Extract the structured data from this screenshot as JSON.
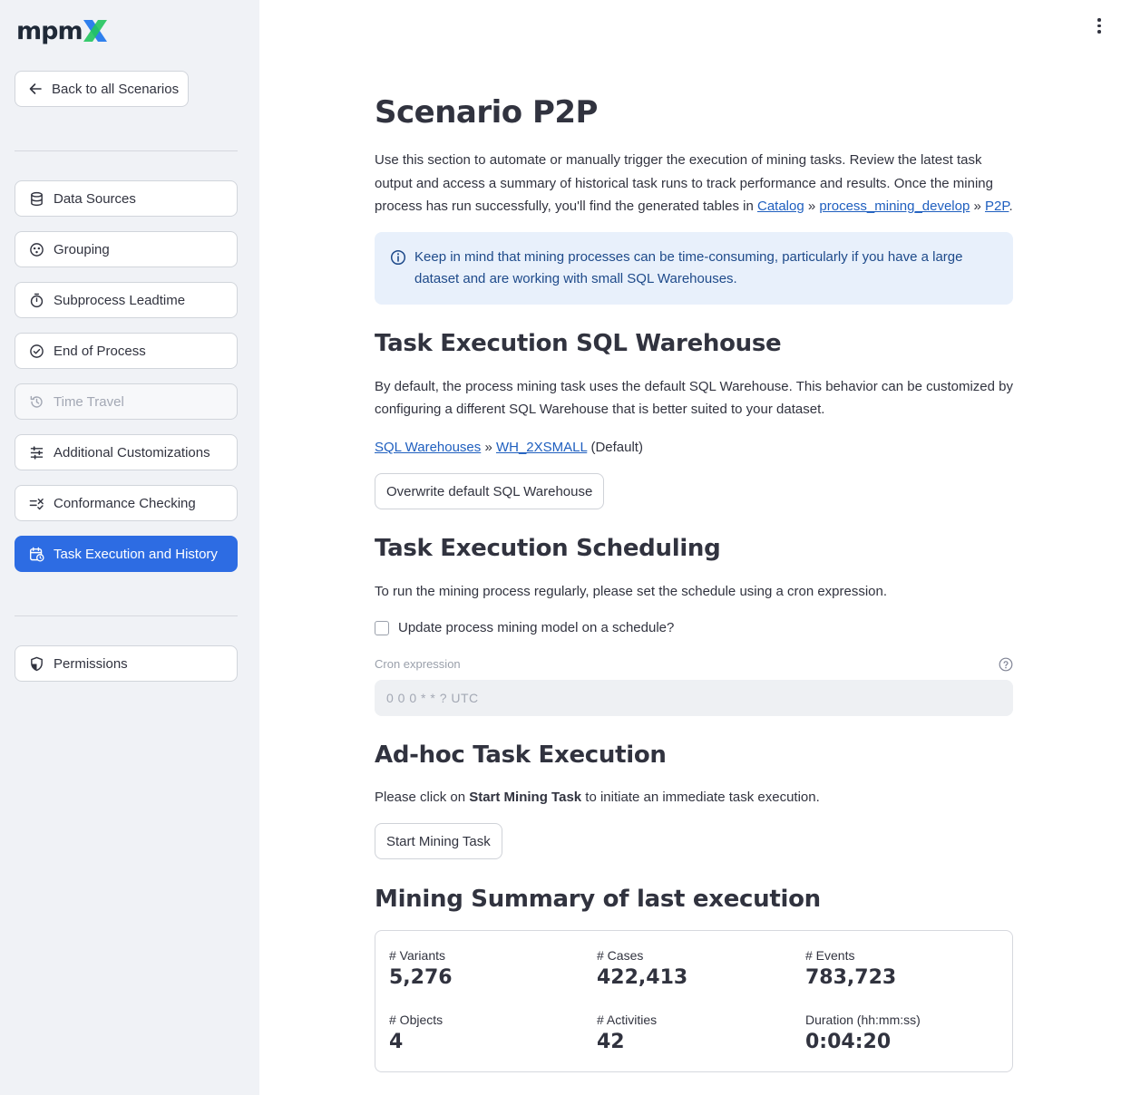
{
  "sidebar": {
    "logo_text": "mpm",
    "logo_mark": "X",
    "back_label": "Back to all Scenarios",
    "items": [
      {
        "label": "Data Sources",
        "icon": "database-icon"
      },
      {
        "label": "Grouping",
        "icon": "grouping-icon"
      },
      {
        "label": "Subprocess Leadtime",
        "icon": "stopwatch-icon"
      },
      {
        "label": "End of Process",
        "icon": "check-circle-icon"
      },
      {
        "label": "Time Travel",
        "icon": "history-icon",
        "disabled": true
      },
      {
        "label": "Additional Customizations",
        "icon": "sliders-icon"
      },
      {
        "label": "Conformance Checking",
        "icon": "conformance-icon"
      },
      {
        "label": "Task Execution and History",
        "icon": "calendar-clock-icon",
        "active": true
      }
    ],
    "permissions_label": "Permissions"
  },
  "main": {
    "title": "Scenario P2P",
    "intro_text": "Use this section to automate or manually trigger the execution of mining tasks. Review the latest task output and access a summary of historical task runs to track performance and results. Once the mining process has run successfully, you'll find the generated tables in ",
    "intro_links": [
      "Catalog",
      "process_mining_develop",
      "P2P"
    ],
    "info_text": "Keep in mind that mining processes can be time-consuming, particularly if you have a large dataset and are working with small SQL Warehouses.",
    "warehouse": {
      "heading": "Task Execution SQL Warehouse",
      "text": "By default, the process mining task uses the default SQL Warehouse. This behavior can be customized by configuring a different SQL Warehouse that is better suited to your dataset.",
      "link1": "SQL Warehouses",
      "link2": "WH_2XSMALL",
      "suffix": "(Default)",
      "button": "Overwrite default SQL Warehouse"
    },
    "scheduling": {
      "heading": "Task Execution Scheduling",
      "text": "To run the mining process regularly, please set the schedule using a cron expression.",
      "checkbox_label": "Update process mining model on a schedule?",
      "field_label": "Cron expression",
      "field_placeholder": "0 0 0 * * ? UTC"
    },
    "adhoc": {
      "heading": "Ad-hoc Task Execution",
      "text_before": "Please click on ",
      "text_bold": "Start Mining Task",
      "text_after": " to initiate an immediate task execution.",
      "button": "Start Mining Task"
    },
    "summary": {
      "heading": "Mining Summary of last execution",
      "metrics": [
        {
          "label": "# Variants",
          "value": "5,276"
        },
        {
          "label": "# Cases",
          "value": "422,413"
        },
        {
          "label": "# Events",
          "value": "783,723"
        },
        {
          "label": "# Objects",
          "value": "4"
        },
        {
          "label": "# Activities",
          "value": "42"
        },
        {
          "label": "Duration (hh:mm:ss)",
          "value": "0:04:20"
        }
      ]
    }
  },
  "colors": {
    "accent": "#2d6ce3",
    "logo_mark_blue": "#2f80ed",
    "logo_mark_green": "#22c55e",
    "info_bg": "#e8f0fb",
    "sidebar_bg": "#f0f2f6"
  }
}
